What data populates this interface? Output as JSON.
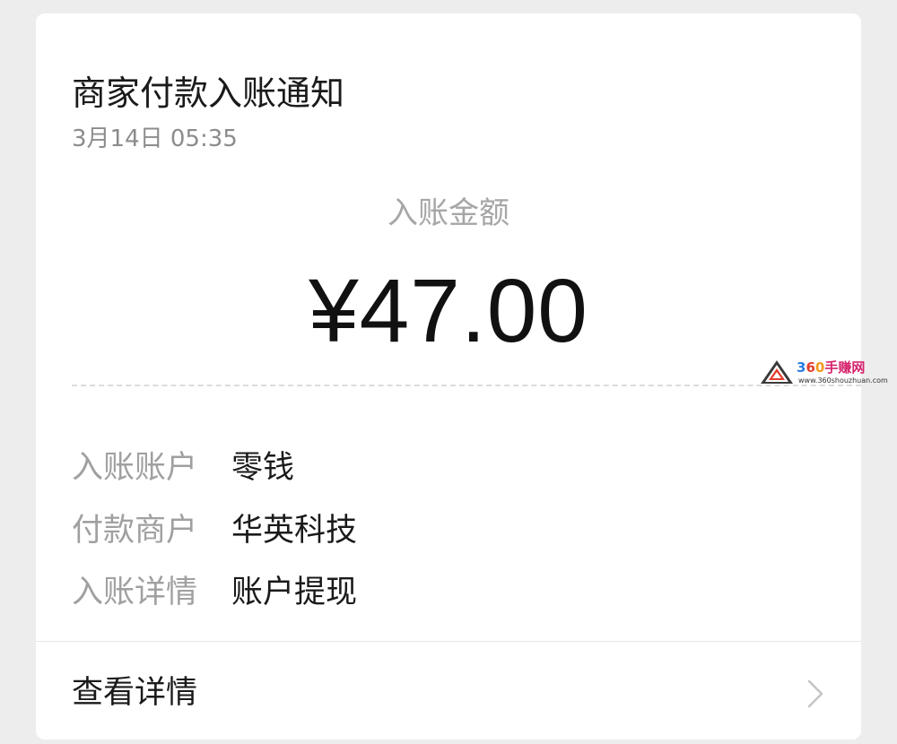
{
  "notification": {
    "title": "商家付款入账通知",
    "timestamp": "3月14日  05:35",
    "amount_label": "入账金额",
    "amount": "¥47.00"
  },
  "details": [
    {
      "key": "入账账户",
      "value": "零钱"
    },
    {
      "key": "付款商户",
      "value": "华英科技"
    },
    {
      "key": "入账详情",
      "value": "账户提现"
    }
  ],
  "footer": {
    "view_details_label": "查看详情",
    "chevron_icon": "chevron-right-icon"
  },
  "watermark": {
    "brand_text": "360手赚网",
    "url_text": "www.360shouzhuan.com",
    "logo_icon": "triangle-logo-icon"
  },
  "colors": {
    "background": "#ededed",
    "card": "#ffffff",
    "primary_text": "#1a1a1a",
    "secondary_text": "#a0a0a0"
  }
}
